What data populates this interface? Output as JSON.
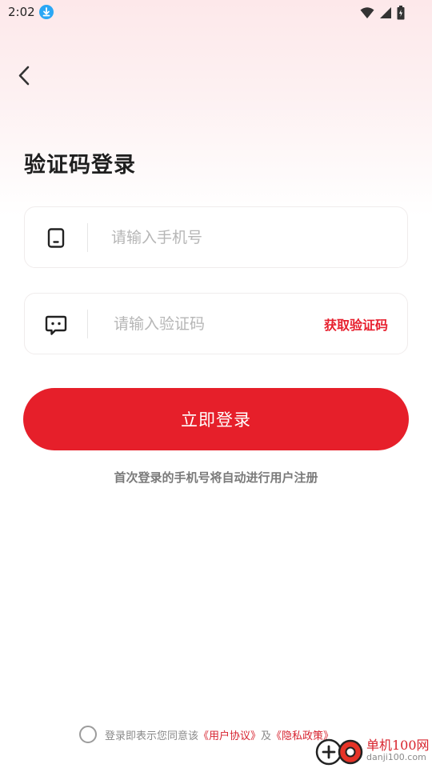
{
  "status_bar": {
    "time": "2:02"
  },
  "page": {
    "title": "验证码登录"
  },
  "phone_field": {
    "placeholder": "请输入手机号"
  },
  "code_field": {
    "placeholder": "请输入验证码",
    "get_code_label": "获取验证码"
  },
  "login_button": {
    "label": "立即登录"
  },
  "hint": "首次登录的手机号将自动进行用户注册",
  "agreement": {
    "prefix": "登录即表示您同意该",
    "user_agreement": "《用户协议》",
    "conjunction": "及",
    "privacy_policy": "《隐私政策》"
  },
  "watermark": {
    "title": "单机100网",
    "domain": "danji100.com"
  },
  "colors": {
    "accent": "#e61f2a",
    "link": "#d7232f",
    "status_download": "#2aa7f5"
  }
}
